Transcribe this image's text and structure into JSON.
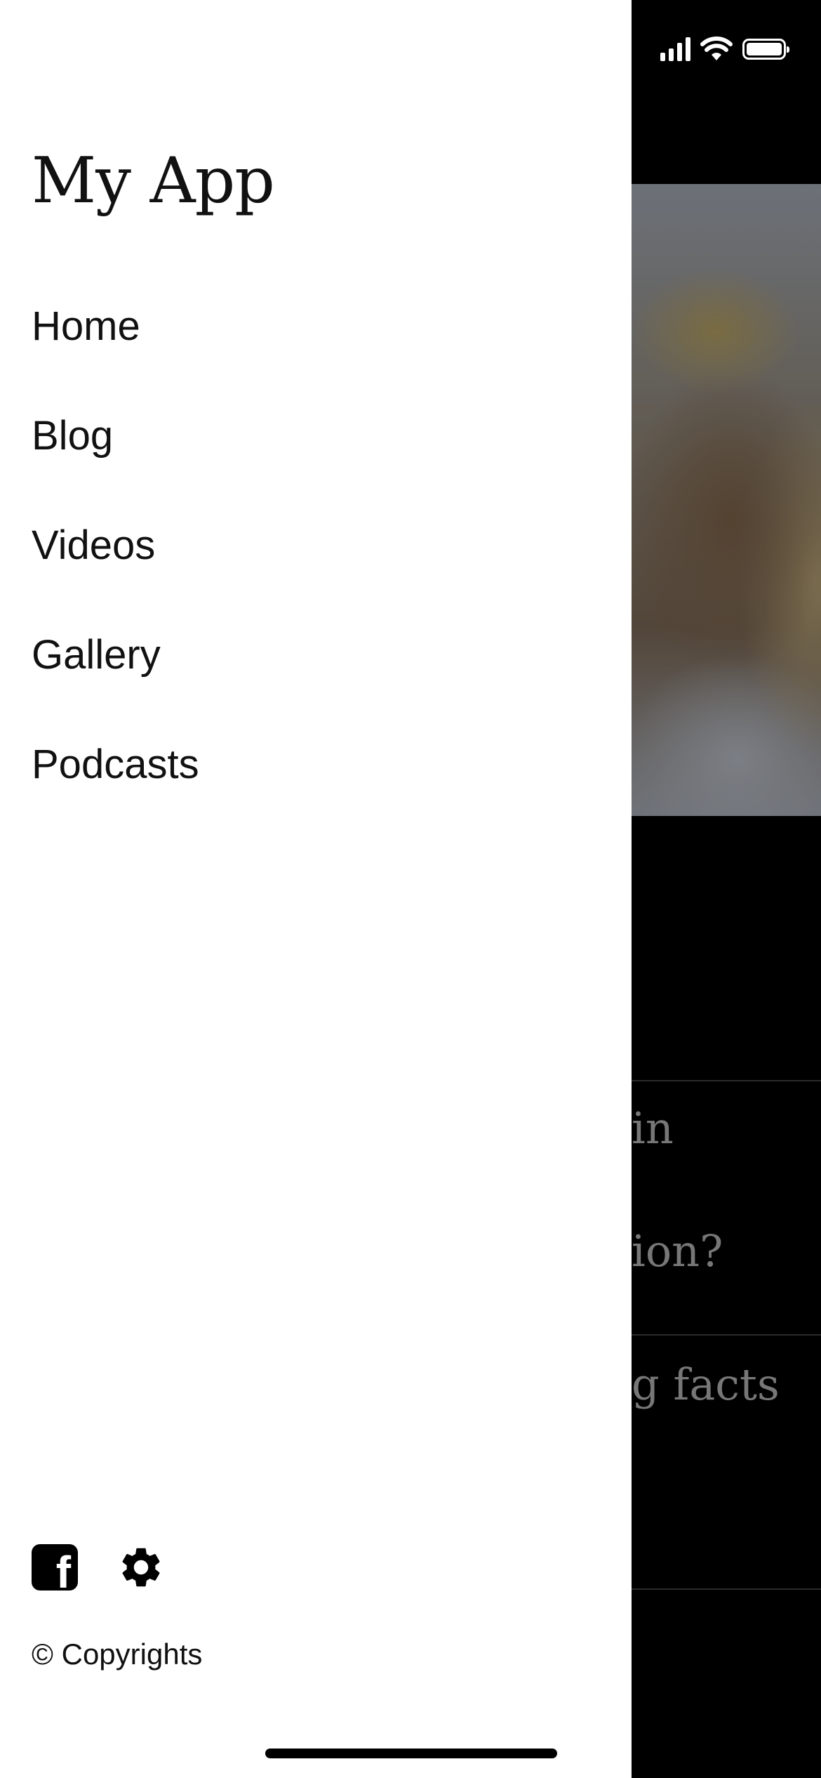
{
  "drawer": {
    "app_title": "My App",
    "nav_items": [
      {
        "label": "Home"
      },
      {
        "label": "Blog"
      },
      {
        "label": "Videos"
      },
      {
        "label": "Gallery"
      },
      {
        "label": "Podcasts"
      }
    ],
    "footer_icons": [
      "facebook-icon",
      "gear-icon"
    ],
    "copyright": "© Copyrights"
  },
  "background": {
    "partial_texts": [
      "in",
      "ion?",
      "g facts"
    ]
  },
  "status_bar": {
    "icons": [
      "signal-icon",
      "wifi-icon",
      "battery-icon"
    ]
  },
  "colors": {
    "drawer_bg": "#ffffff",
    "text": "#111111",
    "backdrop": "#000000"
  }
}
